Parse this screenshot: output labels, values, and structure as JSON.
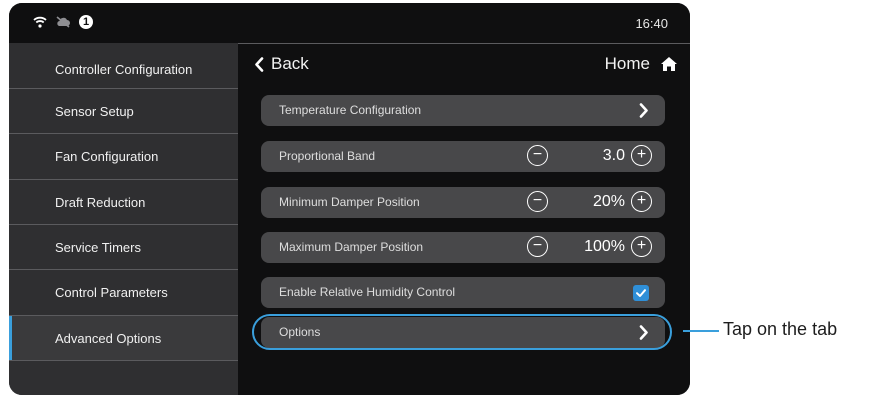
{
  "status": {
    "time": "16:40",
    "icons": [
      "wifi-icon",
      "cloud-off-icon",
      "info-icon"
    ],
    "info_badge": "1"
  },
  "sidebar": {
    "items": [
      {
        "label": "Controller Configuration"
      },
      {
        "label": "Sensor Setup"
      },
      {
        "label": "Fan Configuration"
      },
      {
        "label": "Draft Reduction"
      },
      {
        "label": "Service Timers"
      },
      {
        "label": "Control Parameters"
      },
      {
        "label": "Advanced Options",
        "active": true
      }
    ]
  },
  "header": {
    "back_label": "Back",
    "home_label": "Home"
  },
  "rows": [
    {
      "label": "Temperature Configuration",
      "type": "nav"
    },
    {
      "label": "Proportional Band",
      "type": "stepper",
      "value": "3.0"
    },
    {
      "label": "Minimum Damper Position",
      "type": "stepper",
      "value": "20%"
    },
    {
      "label": "Maximum Damper Position",
      "type": "stepper",
      "value": "100%"
    },
    {
      "label": "Enable Relative Humidity Control",
      "type": "checkbox",
      "checked": true
    },
    {
      "label": "Options",
      "type": "nav",
      "highlighted": true
    }
  ],
  "callout": {
    "text": "Tap on the tab"
  },
  "colors": {
    "accent": "#3a9fdc",
    "sidebar_bg": "#2f2f31",
    "row_bg": "#48484a",
    "device_bg": "#0f0f10",
    "checkbox": "#2f8fd8"
  }
}
